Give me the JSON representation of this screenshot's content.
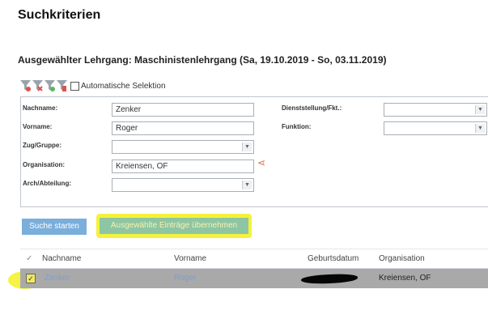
{
  "page": {
    "title": "Suchkriterien",
    "course_heading": "Ausgewählter Lehrgang: Maschinistenlehrgang (Sa, 19.10.2019 - So, 03.11.2019)"
  },
  "filters": {
    "auto_selection_label": "Automatische Selektion",
    "colors": [
      "#d9534f",
      "#5cb85c",
      "#d9534f",
      "#e0a020"
    ]
  },
  "form": {
    "left": [
      {
        "label": "Nachname:",
        "value": "Zenker",
        "type": "text"
      },
      {
        "label": "Vorname:",
        "value": "Roger",
        "type": "text"
      },
      {
        "label": "Zug/Gruppe:",
        "value": "",
        "type": "select"
      },
      {
        "label": "Organisation:",
        "value": "Kreiensen, OF",
        "type": "text"
      },
      {
        "label": "Arch/Abteilung:",
        "value": "",
        "type": "select"
      }
    ],
    "right": [
      {
        "label": "Dienststellung/Fkt.:",
        "value": "",
        "type": "select"
      },
      {
        "label": "Funktion:",
        "value": "",
        "type": "select"
      }
    ]
  },
  "actions": {
    "search_label": "Suche starten",
    "apply_label": "Ausgewählte Einträge übernehmen"
  },
  "grid": {
    "columns": {
      "nachname": "Nachname",
      "vorname": "Vorname",
      "geburtsdatum": "Geburtsdatum",
      "organisation": "Organisation"
    },
    "rows": [
      {
        "checked": true,
        "nachname": "Zenker",
        "vorname": "Roger",
        "geburtsdatum": "",
        "organisation": "Kreiensen, OF"
      }
    ]
  },
  "colors": {
    "highlight": "#f4f23c",
    "search_button": "#7aaedb",
    "apply_button": "#8ec5a2",
    "selected_row": "#a9a9a9",
    "link": "#7b9fd6"
  }
}
